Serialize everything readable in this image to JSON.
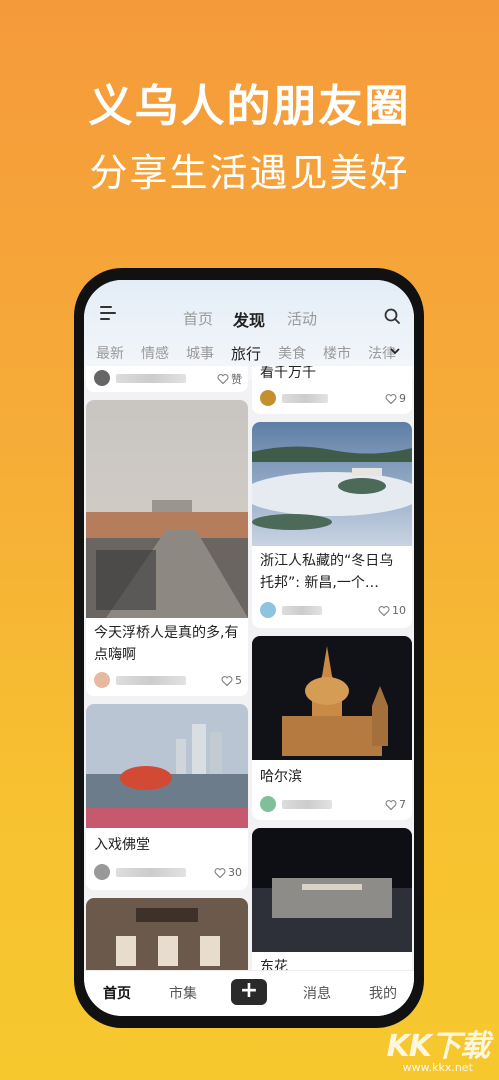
{
  "headline": {
    "title": "义乌人的朋友圈",
    "subtitle": "分享生活遇见美好"
  },
  "nav": {
    "tabs": [
      "首页",
      "发现",
      "活动"
    ],
    "active_tab": "发现"
  },
  "categories": [
    "最新",
    "情感",
    "城事",
    "旅行",
    "美食",
    "楼市",
    "法律"
  ],
  "active_category": "旅行",
  "feed": {
    "left": [
      {
        "title": "",
        "likes": "赞"
      },
      {
        "title": "今天浮桥人是真的多,有点嗨啊",
        "likes": "5"
      },
      {
        "title": "入戏佛堂",
        "likes": "30"
      }
    ],
    "right": [
      {
        "title": "看千万千",
        "likes": "9"
      },
      {
        "title": "浙江人私藏的“冬日乌托邦”: 新昌,一个…",
        "likes": "10"
      },
      {
        "title": "哈尔滨",
        "likes": "7"
      },
      {
        "title": "东花",
        "likes": ""
      }
    ]
  },
  "bottom_nav": {
    "items": [
      "首页",
      "市集",
      "+",
      "消息",
      "我的"
    ],
    "active": "首页"
  },
  "watermark": {
    "logo": "KK下载",
    "url": "www.kkx.net"
  },
  "colors": {
    "bg_top": "#f59a3b",
    "bg_bottom": "#f6c82e",
    "accent_dark": "#2a2a2a"
  }
}
